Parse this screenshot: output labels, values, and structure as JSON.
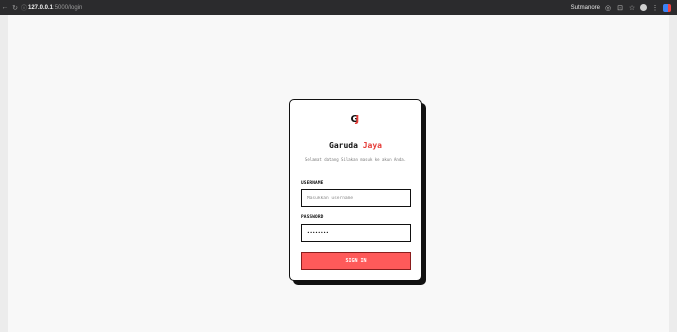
{
  "browser": {
    "url_host": "127.0.0.1",
    "url_path": ":5000/login",
    "profile_label": "Sutmanore"
  },
  "login": {
    "brand_main": "Garuda ",
    "brand_accent": "Jaya",
    "welcome_text": "Selamat datang Silakan masuk ke akun Anda.",
    "username_label": "USERNAME",
    "username_placeholder": "Masukkan username",
    "password_label": "PASSWORD",
    "password_value": "••••••••",
    "signin_label": "SIGN IN"
  },
  "colors": {
    "accent": "#e53935",
    "button": "#ff5a5a",
    "border": "#111111"
  },
  "icons": [
    "back-icon",
    "refresh-icon",
    "info-icon",
    "profile-icon",
    "extension-icon",
    "bookmark-star-icon",
    "menu-dots-icon"
  ]
}
